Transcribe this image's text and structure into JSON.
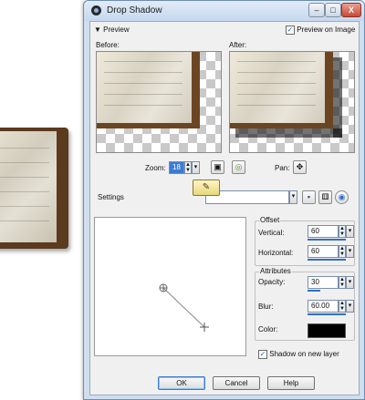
{
  "window": {
    "title": "Drop Shadow",
    "buttons": {
      "minimize": "–",
      "maximize": "□",
      "close": "X"
    }
  },
  "preview": {
    "toggle_label": "Preview",
    "preview_on_image_label": "Preview on Image",
    "preview_on_image_checked": true,
    "before_label": "Before:",
    "after_label": "After:"
  },
  "zoom": {
    "label": "Zoom:",
    "value": "18"
  },
  "pan": {
    "label": "Pan:"
  },
  "settings": {
    "label": "Settings",
    "value": ""
  },
  "offset": {
    "title": "Offset",
    "vertical_label": "Vertical:",
    "vertical_value": "60",
    "horizontal_label": "Horizontal:",
    "horizontal_value": "60"
  },
  "attributes": {
    "title": "Attributes",
    "opacity_label": "Opacity:",
    "opacity_value": "30",
    "blur_label": "Blur:",
    "blur_value": "60.00",
    "color_label": "Color:",
    "color_value": "#000000"
  },
  "shadow_on_new_layer": {
    "label": "Shadow on new layer",
    "checked": true
  },
  "footer": {
    "ok": "OK",
    "cancel": "Cancel",
    "help": "Help"
  },
  "icons": [
    "app-icon",
    "zoom-fit-icon",
    "zoom-actual-icon",
    "pan-move-icon",
    "save-preset-icon",
    "delete-preset-icon",
    "reset-icon",
    "randomize-tooltip-icon"
  ],
  "colors": {
    "accent": "#2f6fc8",
    "shadow_color": "#000000"
  }
}
